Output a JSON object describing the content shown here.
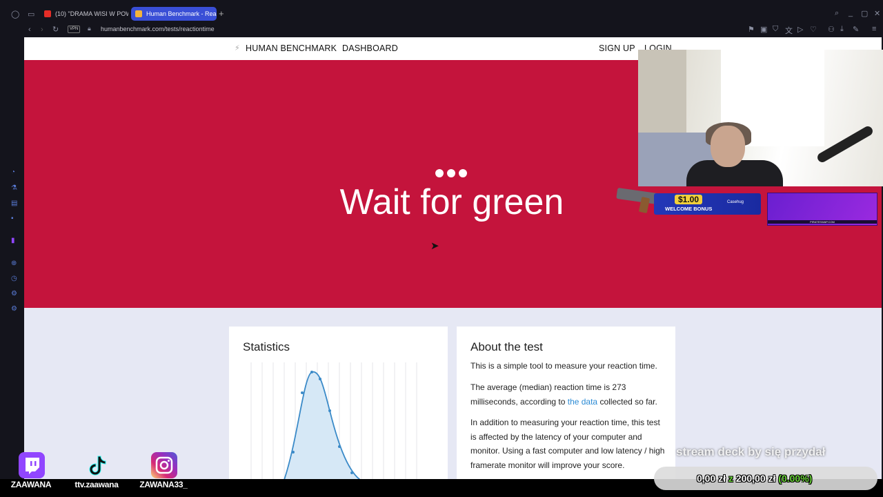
{
  "browser": {
    "tabs": [
      {
        "label": "(10) \"DRAMA WISI W POW"
      },
      {
        "label": "Human Benchmark - Reac"
      }
    ],
    "new_tab": "+",
    "vpn_label": "VPN",
    "url": "humanbenchmark.com/tests/reactiontime"
  },
  "site": {
    "brand": "HUMAN BENCHMARK",
    "nav_dashboard": "DASHBOARD",
    "sign_up": "SIGN UP",
    "login": "LOGIN"
  },
  "hero": {
    "title": "Wait for green",
    "background": "#c4143c"
  },
  "statistics": {
    "title": "Statistics"
  },
  "about": {
    "title": "About the test",
    "p1": "This is a simple tool to measure your reaction time.",
    "p2_a": "The average (median) reaction time is 273 milliseconds, according to ",
    "p2_link": "the data",
    "p2_b": " collected so far.",
    "p3": "In addition to measuring your reaction time, this test is affected by the latency of your computer and monitor. Using a fast computer and low latency / high framerate monitor will improve your score."
  },
  "overlay": {
    "banner_amount": "$1.00",
    "banner_sub": "WELCOME BONUS",
    "banner_brand": "Casehug",
    "purple_label": "PIRATESWAP.COM",
    "socials": [
      {
        "label": "ZAAWANA",
        "color": "#9146ff"
      },
      {
        "label": "ttv.zaawana",
        "color": "#111111"
      },
      {
        "label": "ZAWANA33_",
        "color": "#d6249f"
      }
    ],
    "goal_text": "stream deck by się przydał",
    "goal_current": "0,00 zł",
    "goal_sep": " z ",
    "goal_target": "200,00 zł",
    "goal_percent": " (0.00%)"
  }
}
